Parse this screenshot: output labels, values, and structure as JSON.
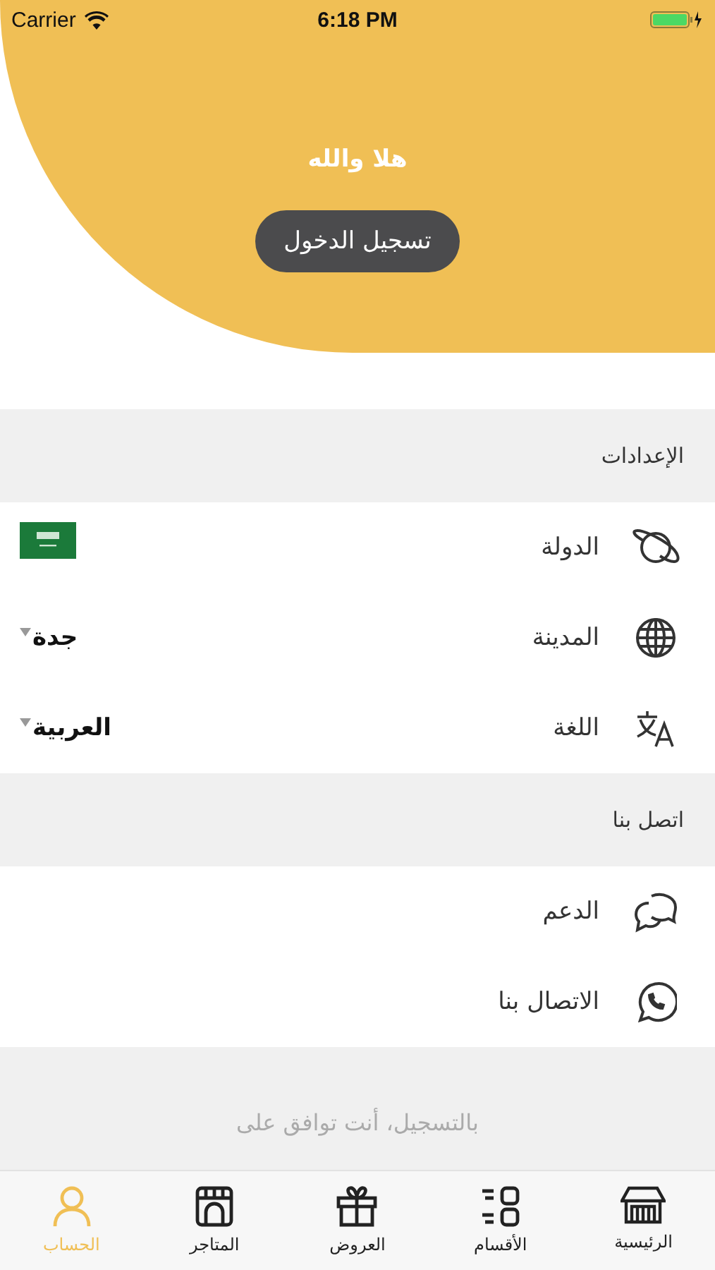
{
  "status_bar": {
    "carrier": "Carrier",
    "time": "6:18 PM"
  },
  "header": {
    "greeting": "هلا والله",
    "login_button": "تسجيل الدخول"
  },
  "settings": {
    "title": "الإعدادات",
    "rows": [
      {
        "label": "الدولة",
        "kind": "flag"
      },
      {
        "label": "المدينة",
        "kind": "dropdown",
        "value": "جدة"
      },
      {
        "label": "اللغة",
        "kind": "dropdown",
        "value": "العربية"
      }
    ]
  },
  "contact": {
    "title": "اتصل بنا",
    "rows": [
      {
        "label": "الدعم"
      },
      {
        "label": "الاتصال بنا"
      }
    ]
  },
  "footer": {
    "agreement": "بالتسجيل، أنت توافق على"
  },
  "tabs": [
    {
      "label": "الرئيسية",
      "selected": false
    },
    {
      "label": "الأقسام",
      "selected": false
    },
    {
      "label": "العروض",
      "selected": false
    },
    {
      "label": "المتاجر",
      "selected": false
    },
    {
      "label": "الحساب",
      "selected": true
    }
  ]
}
